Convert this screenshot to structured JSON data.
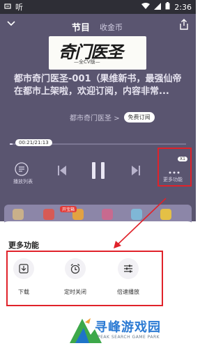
{
  "status_bar": {
    "left_text": "听",
    "time": "2:36"
  },
  "header": {
    "tab_active": "节目",
    "tab_inactive": "收金币"
  },
  "cover": {
    "title_text": "奇门医圣",
    "subtitle_text": "—全CV版—"
  },
  "episode": {
    "title": "都市奇门医圣-001（果维新书，最强仙帝在都市上架啦，欢迎订阅，内容非常..."
  },
  "album": {
    "name": "都市奇门医圣",
    "chevron": ">",
    "subscribe_label": "免费订阅"
  },
  "progress": {
    "time_text": "00:21/21:13",
    "ratio": 0.0165
  },
  "controls": {
    "playlist_label": "播放列表",
    "more_label": "更多功能",
    "speed_badge": "X1"
  },
  "strip": {
    "tag": "开宝箱"
  },
  "sheet": {
    "title": "更多功能",
    "items": [
      {
        "label": "下载",
        "icon": "download-icon"
      },
      {
        "label": "定时关闭",
        "icon": "alarm-clock-icon"
      },
      {
        "label": "倍速播放",
        "icon": "speed-sliders-icon"
      }
    ]
  },
  "watermark": {
    "text": "寻峰游戏园",
    "sub": "PEAK SEARCH GAME PARK"
  },
  "colors": {
    "player_bg": "#5a5570",
    "highlight": "#e0222a",
    "watermark": "#2b7ad3"
  }
}
